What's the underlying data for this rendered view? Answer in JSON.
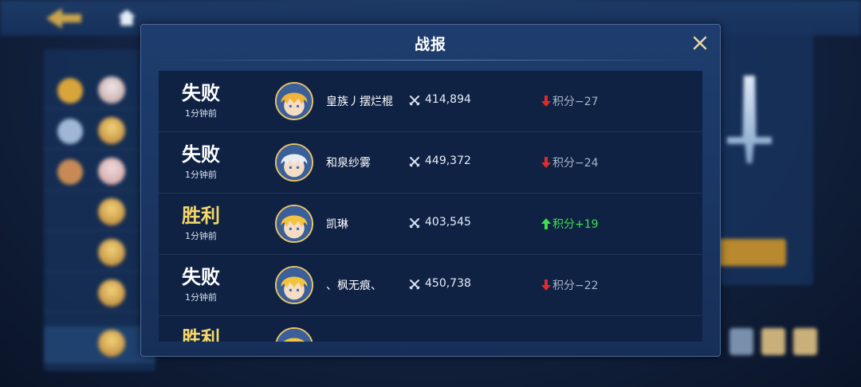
{
  "dialog": {
    "title": "战报"
  },
  "records": [
    {
      "result": "失败",
      "outcome": "lose",
      "time": "1分钟前",
      "name": "皇族丿摆烂棍",
      "power": "414,894",
      "score": "积分−27",
      "avatar_hair": "#f0b43a"
    },
    {
      "result": "失败",
      "outcome": "lose",
      "time": "1分钟前",
      "name": "和泉纱雾",
      "power": "449,372",
      "score": "积分−24",
      "avatar_hair": "#e8edf4"
    },
    {
      "result": "胜利",
      "outcome": "win",
      "time": "1分钟前",
      "name": "凯琳",
      "power": "403,545",
      "score": "积分+19",
      "avatar_hair": "#f2c43e"
    },
    {
      "result": "失败",
      "outcome": "lose",
      "time": "1分钟前",
      "name": "、枫无痕、",
      "power": "450,738",
      "score": "积分−22",
      "avatar_hair": "#f2c43e"
    },
    {
      "result": "胜利",
      "outcome": "win",
      "time": "",
      "name": "",
      "power": "",
      "score": "",
      "avatar_hair": "#f2c43e"
    }
  ],
  "colors": {
    "win_text": "#f6d86a",
    "lose_text": "#ffffff",
    "score_up": "#3ee04c",
    "score_down": "#e02b2b"
  },
  "icons": {
    "close": "close-icon",
    "power": "crossed-swords-icon",
    "score_down": "arrow-down-icon",
    "score_up": "arrow-up-icon"
  }
}
